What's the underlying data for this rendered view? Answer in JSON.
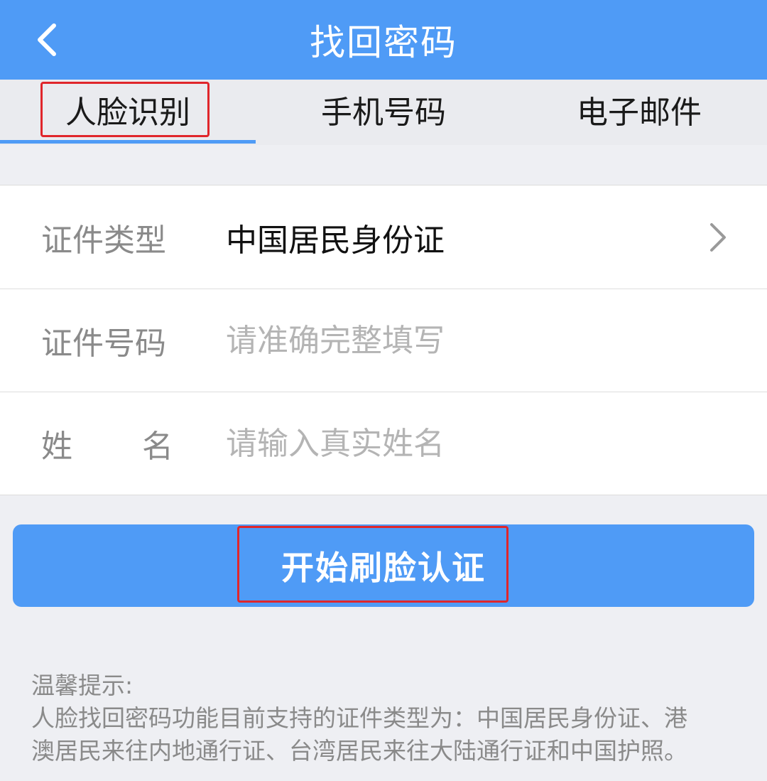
{
  "header": {
    "title": "找回密码",
    "back_icon": "chevron-left-icon"
  },
  "tabs": [
    {
      "label": "人脸识别",
      "active": true
    },
    {
      "label": "手机号码",
      "active": false
    },
    {
      "label": "电子邮件",
      "active": false
    }
  ],
  "form": {
    "id_type": {
      "label": "证件类型",
      "value": "中国居民身份证"
    },
    "id_number": {
      "label": "证件号码",
      "placeholder": "请准确完整填写"
    },
    "name": {
      "label_first": "姓",
      "label_second": "名",
      "placeholder": "请输入真实姓名"
    }
  },
  "start_button": {
    "label": "开始刷脸认证"
  },
  "tips": {
    "title": "温馨提示:",
    "line1": "人脸找回密码功能目前支持的证件类型为：中国居民身份证、港",
    "line2": "澳居民来往内地通行证、台湾居民来往大陆通行证和中国护照。"
  },
  "colors": {
    "brand": "#4f9bf6",
    "highlight": "#e0262b"
  }
}
